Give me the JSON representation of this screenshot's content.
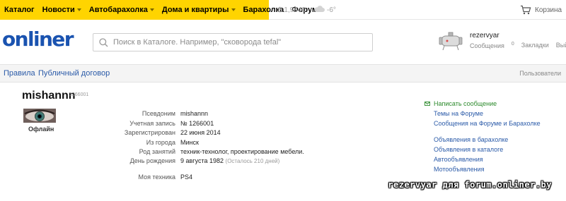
{
  "topnav": {
    "items": [
      {
        "label": "Каталог",
        "caret": false
      },
      {
        "label": "Новости",
        "caret": true
      },
      {
        "label": "Автобарахолка",
        "caret": true
      },
      {
        "label": "Дома и квартиры",
        "caret": true
      },
      {
        "label": "Барахолка",
        "caret": false
      },
      {
        "label": "Форум",
        "caret": false
      }
    ],
    "currency": "$ 1,9640",
    "weather": "-6°",
    "cart_label": "Корзина",
    "accent_color": "#ffd400"
  },
  "header": {
    "logo": "onliner",
    "search_placeholder": "Поиск в Каталоге. Например, \"сковорода tefal\"",
    "user": {
      "name": "rezervyar",
      "messages_label": "Сообщения",
      "messages_count": "0",
      "bookmarks_label": "Закладки",
      "logout_label": "Выйти"
    }
  },
  "subnav": {
    "rules": "Правила",
    "contract": "Публичный договор",
    "users": "Пользователи"
  },
  "profile": {
    "nickname": "mishannn",
    "id_small": "1266001",
    "status": "Офлайн",
    "fields": [
      {
        "label": "Псевдоним",
        "value": "mishannn",
        "note": ""
      },
      {
        "label": "Учетная запись",
        "value": "№ 1266001",
        "note": ""
      },
      {
        "label": "Зарегистрирован",
        "value": "22 июня 2014",
        "note": ""
      },
      {
        "label": "Из города",
        "value": "Минск",
        "note": ""
      },
      {
        "label": "Род занятий",
        "value": "техник-технолог, проектирование мебели.",
        "note": ""
      },
      {
        "label": "День рождения",
        "value": "9 августа 1982",
        "note": "(Осталось 210 дней)"
      },
      {
        "label": "Моя техника",
        "value": "PS4",
        "note": ""
      }
    ]
  },
  "sidebar": {
    "send_message": "Написать сообщение",
    "links_group1": [
      "Темы на Форуме",
      "Сообщения на Форуме и Барахолке"
    ],
    "links_group2": [
      "Объявления в барахолке",
      "Объявления в каталоге",
      "Автообъявления",
      "Мотообъявления"
    ]
  },
  "watermark": "rezervyar для forum.onliner.by"
}
